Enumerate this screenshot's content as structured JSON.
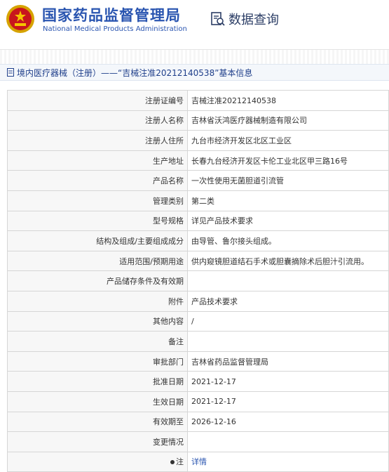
{
  "header": {
    "title_cn": "国家药品监督管理局",
    "title_en": "National Medical Products Administration",
    "query_label": "数据查询"
  },
  "breadcrumb": {
    "text": "境内医疗器械（注册）——“吉械注准20212140538”基本信息"
  },
  "rows": [
    {
      "label": "注册证编号",
      "value": "吉械注准20212140538"
    },
    {
      "label": "注册人名称",
      "value": "吉林省沃鸿医疗器械制造有限公司"
    },
    {
      "label": "注册人住所",
      "value": "九台市经济开发区北区工业区"
    },
    {
      "label": "生产地址",
      "value": "长春九台经济开发区卡伦工业北区甲三路16号"
    },
    {
      "label": "产品名称",
      "value": "一次性使用无菌胆道引流管"
    },
    {
      "label": "管理类别",
      "value": "第二类"
    },
    {
      "label": "型号规格",
      "value": "详见产品技术要求"
    },
    {
      "label": "结构及组成/主要组成成分",
      "value": "由导管、鲁尔接头组成。"
    },
    {
      "label": "适用范围/预期用途",
      "value": "供内窥镜胆道结石手术或胆囊摘除术后胆汁引流用。"
    },
    {
      "label": "产品储存条件及有效期",
      "value": ""
    },
    {
      "label": "附件",
      "value": "产品技术要求"
    },
    {
      "label": "其他内容",
      "value": "/"
    },
    {
      "label": "备注",
      "value": ""
    },
    {
      "label": "审批部门",
      "value": "吉林省药品监督管理局"
    },
    {
      "label": "批准日期",
      "value": "2021-12-17"
    },
    {
      "label": "生效日期",
      "value": "2021-12-17"
    },
    {
      "label": "有效期至",
      "value": "2026-12-16"
    },
    {
      "label": "变更情况",
      "value": ""
    }
  ],
  "note_row": {
    "label": "注",
    "link": "详情"
  }
}
